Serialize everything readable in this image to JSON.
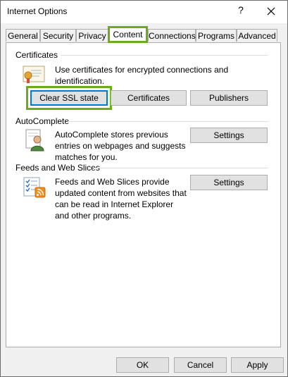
{
  "window": {
    "title": "Internet Options"
  },
  "titlebar": {
    "help_label": "?"
  },
  "tabs": [
    {
      "label": "General"
    },
    {
      "label": "Security"
    },
    {
      "label": "Privacy"
    },
    {
      "label": "Content",
      "active": true
    },
    {
      "label": "Connections"
    },
    {
      "label": "Programs"
    },
    {
      "label": "Advanced"
    }
  ],
  "certificates": {
    "heading": "Certificates",
    "description": "Use certificates for encrypted connections and identification.",
    "clear_ssl_label": "Clear SSL state",
    "certificates_label": "Certificates",
    "publishers_label": "Publishers",
    "icon": "certificate-icon"
  },
  "autocomplete": {
    "heading": "AutoComplete",
    "description": "AutoComplete stores previous entries on webpages and suggests matches for you.",
    "settings_label": "Settings",
    "icon": "autocomplete-icon"
  },
  "feeds": {
    "heading": "Feeds and Web Slices",
    "description": "Feeds and Web Slices provide updated content from websites that can be read in Internet Explorer and other programs.",
    "settings_label": "Settings",
    "icon": "feeds-icon"
  },
  "footer": {
    "ok_label": "OK",
    "cancel_label": "Cancel",
    "apply_label": "Apply"
  },
  "colors": {
    "highlight": "#6aad19",
    "focus": "#0078d7"
  }
}
